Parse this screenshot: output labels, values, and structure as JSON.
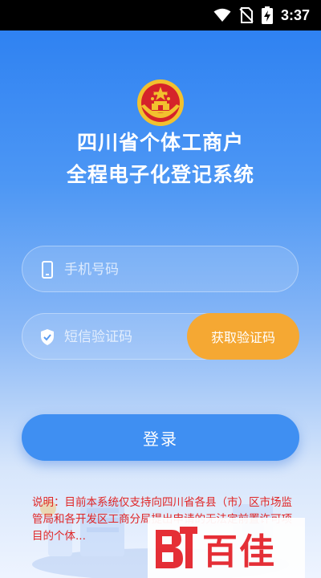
{
  "status_bar": {
    "time": "3:37",
    "icons": [
      "wifi-icon",
      "no-sim-icon",
      "battery-charging-icon"
    ]
  },
  "header": {
    "emblem": "national-emblem",
    "title_line1": "四川省个体工商户",
    "title_line2": "全程电子化登记系统"
  },
  "form": {
    "phone_placeholder": "手机号码",
    "phone_icon": "phone-icon",
    "code_placeholder": "短信验证码",
    "code_icon": "shield-check-icon",
    "get_code_label": "获取验证码",
    "login_label": "登录"
  },
  "notice": {
    "text": "说明：目前本系统仅支持向四川省各县（市）区市场监管局和各开发区工商分局提出申请的无法定前置许可项目的个体..."
  },
  "watermark": {
    "text": "百佳"
  },
  "colors": {
    "primary": "#3f8ff2",
    "accent_orange": "#f5a833",
    "notice_red": "#e02626"
  }
}
